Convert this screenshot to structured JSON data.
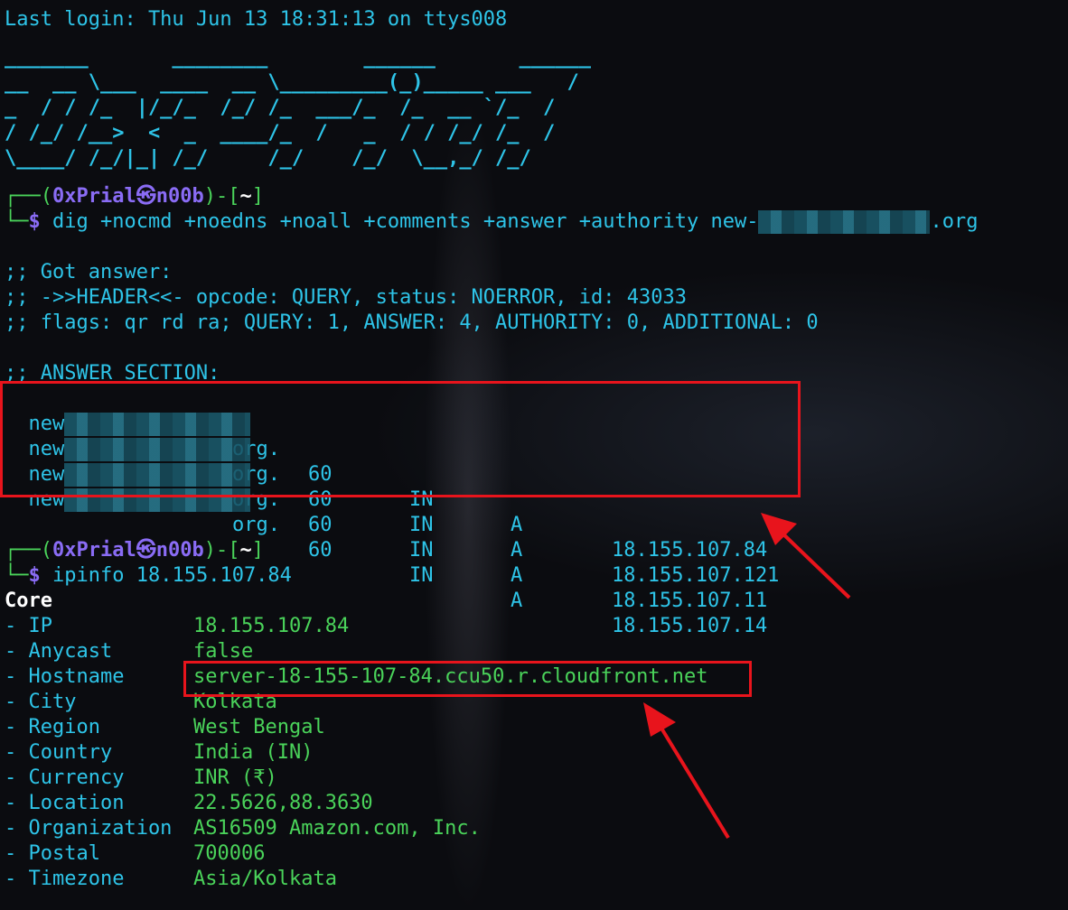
{
  "last_login": "Last login: Thu Jun 13 18:31:13 on ttys008",
  "banner": [
    "_______       ________        ______       ______",
    "__  __ \\___  ____  __ \\_________(_)_____ ___   /",
    "_  / / /_  |/_/_  /_/ /_  ___/_  /_  __ `/_  /",
    "/ /_/ /__>  <  _  ____/_  /   _  / / /_/ /_  /",
    "\\____/ /_/|_| /_/     /_/    /_/  \\__,_/ /_/"
  ],
  "prompt": {
    "open": "┌──(",
    "user": "0xPrial",
    "at_symbol": "㉿",
    "host": "n00b",
    "mid": ")-[",
    "dir": "~",
    "close": "]",
    "cmd_prefix": "└─",
    "dollar": "$"
  },
  "command1": {
    "text": "dig +nocmd +noedns +noall +comments +answer +authority new-",
    "suffix": ".org"
  },
  "dig_output": [
    ";; Got answer:",
    ";; ->>HEADER<<- opcode: QUERY, status: NOERROR, id: 43033",
    ";; flags: qr rd ra; QUERY: 1, ANSWER: 4, AUTHORITY: 0, ADDITIONAL: 0",
    ";; ANSWER SECTION:"
  ],
  "answers": [
    {
      "name_prefix": "new",
      "name_suffix": "org.",
      "ttl": "60",
      "class": "IN",
      "type": "A",
      "ip": "18.155.107.84"
    },
    {
      "name_prefix": "new",
      "name_suffix": "org.",
      "ttl": "60",
      "class": "IN",
      "type": "A",
      "ip": "18.155.107.121"
    },
    {
      "name_prefix": "new",
      "name_suffix": "org.",
      "ttl": "60",
      "class": "IN",
      "type": "A",
      "ip": "18.155.107.11"
    },
    {
      "name_prefix": "new",
      "name_suffix": "org.",
      "ttl": "60",
      "class": "IN",
      "type": "A",
      "ip": "18.155.107.14"
    }
  ],
  "command2": {
    "cmd": "ipinfo",
    "arg": "18.155.107.84"
  },
  "core_heading": "Core",
  "core_rows": [
    {
      "key": "- IP",
      "value": "18.155.107.84"
    },
    {
      "key": "- Anycast",
      "value": "false"
    },
    {
      "key": "- Hostname",
      "value": "server-18-155-107-84.ccu50.r.cloudfront.net"
    },
    {
      "key": "- City",
      "value": "Kolkata"
    },
    {
      "key": "- Region",
      "value": "West Bengal"
    },
    {
      "key": "- Country",
      "value": "India (IN)"
    },
    {
      "key": "- Currency",
      "value": "INR (₹)"
    },
    {
      "key": "- Location",
      "value": "22.5626,88.3630"
    },
    {
      "key": "- Organization",
      "value": "AS16509 Amazon.com, Inc."
    },
    {
      "key": "- Postal",
      "value": "700006"
    },
    {
      "key": "- Timezone",
      "value": "Asia/Kolkata"
    }
  ],
  "colors": {
    "background": "#0b0c10",
    "cyan_text": "#2ec4e8",
    "green_text": "#4ad35a",
    "prompt_purple": "#8a6cf5",
    "highlight_red": "#e8141c"
  }
}
